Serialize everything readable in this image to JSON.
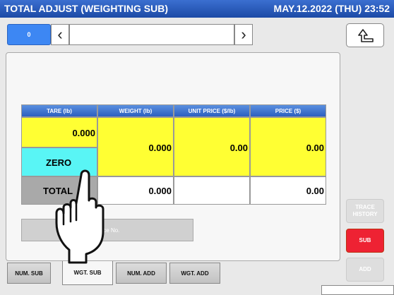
{
  "header": {
    "title": "TOTAL ADJUST (WEIGHTING SUB)",
    "datetime": "MAY.12.2022 (THU)  23:52"
  },
  "pager": {
    "page": "0",
    "prev_icon": "chevron-left-icon",
    "next_icon": "chevron-right-icon",
    "field_value": ""
  },
  "back_icon": "return-arrow-icon",
  "table": {
    "headers": [
      "TARE (lb)",
      "WEIGHT (lb)",
      "UNIT PRICE ($/lb)",
      "PRICE ($)"
    ],
    "tare": "0.000",
    "weight": "0.000",
    "unit_price": "0.00",
    "price": "0.00",
    "zero_label": "ZERO",
    "total_label": "TOTAL",
    "total_weight": "0.000",
    "total_unit_price": "",
    "total_price": "0.00"
  },
  "trace_no_label": "Trace No.",
  "tabs": [
    "NUM. SUB",
    "WGT. SUB",
    "NUM. ADD",
    "WGT. ADD"
  ],
  "active_tab": "WGT. SUB",
  "side_buttons": {
    "trace_history": "TRACE HISTORY",
    "sub": "SUB",
    "add": "ADD"
  },
  "colors": {
    "accent_blue": "#3d87f3",
    "yellow_cell": "#ffff33",
    "cyan_cell": "#59f5f5",
    "sub_red": "#ee2233"
  }
}
